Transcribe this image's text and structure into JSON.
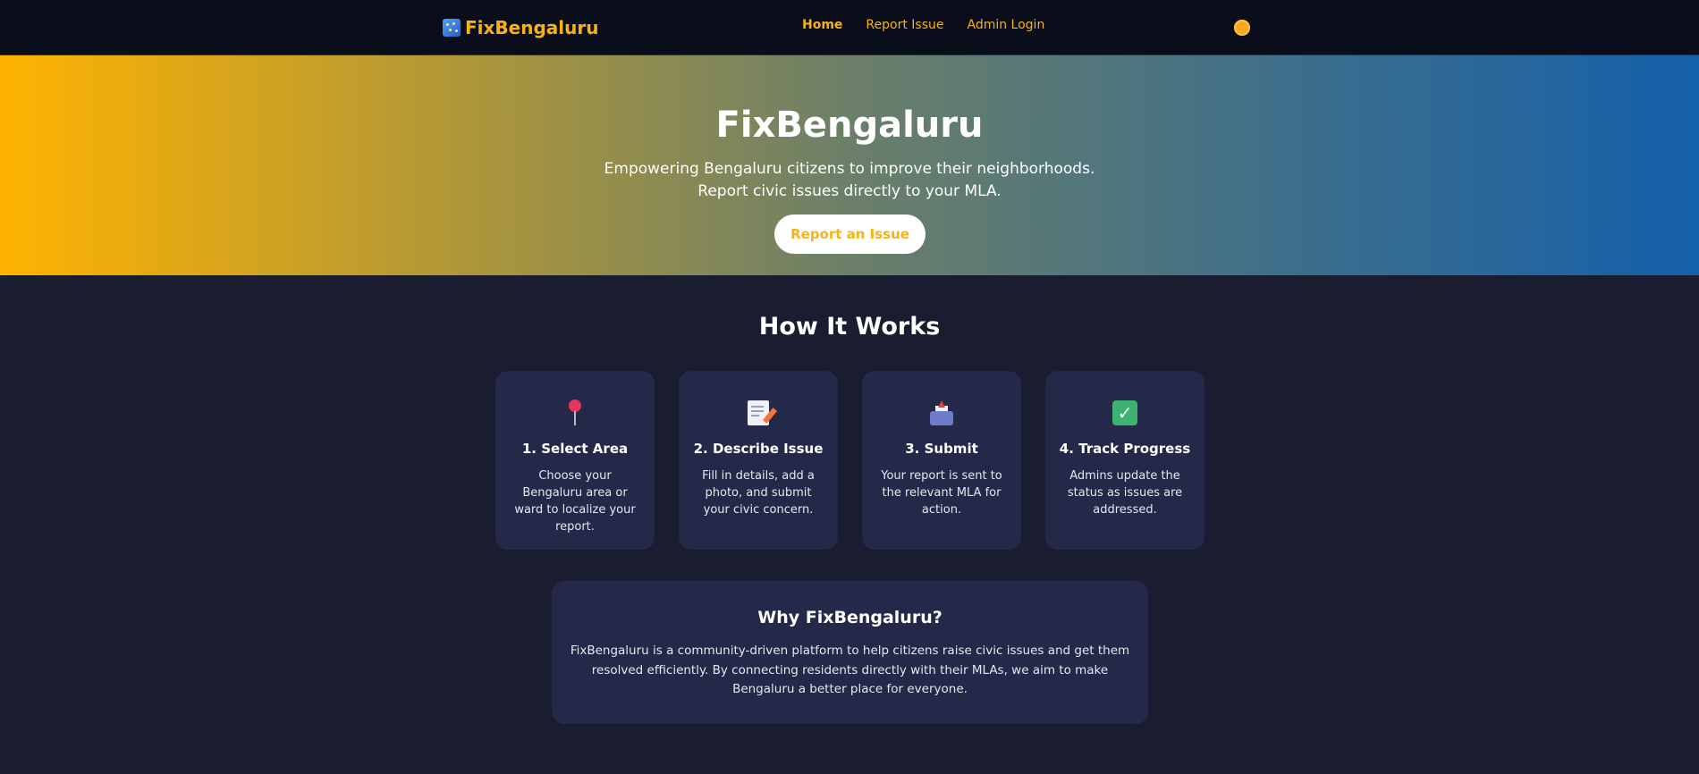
{
  "nav": {
    "brand": "FixBengaluru",
    "links": [
      "Home",
      "Report Issue",
      "Admin Login"
    ]
  },
  "hero": {
    "title": "FixBengaluru",
    "subtitle_line1": "Empowering Bengaluru citizens to improve their neighborhoods.",
    "subtitle_line2": "Report civic issues directly to your MLA.",
    "cta": "Report an Issue"
  },
  "how": {
    "title": "How It Works",
    "steps": [
      {
        "icon": "pushpin-icon",
        "title": "1. Select Area",
        "desc": "Choose your Bengaluru area or ward to localize your report."
      },
      {
        "icon": "memo-icon",
        "title": "2. Describe Issue",
        "desc": "Fill in details, add a photo, and submit your civic concern."
      },
      {
        "icon": "outbox-icon",
        "title": "3. Submit",
        "desc": "Your report is sent to the relevant MLA for action."
      },
      {
        "icon": "check-icon",
        "title": "4. Track Progress",
        "desc": "Admins update the status as issues are addressed."
      }
    ]
  },
  "why": {
    "title": "Why FixBengaluru?",
    "text": "FixBengaluru is a community-driven platform to help citizens raise civic issues and get them resolved efficiently. By connecting residents directly with their MLAs, we aim to make Bengaluru a better place for everyone."
  },
  "colors": {
    "accent": "#fbb116",
    "background": "#1a1d30",
    "card": "#242849",
    "navbar": "#0a0e1a"
  }
}
